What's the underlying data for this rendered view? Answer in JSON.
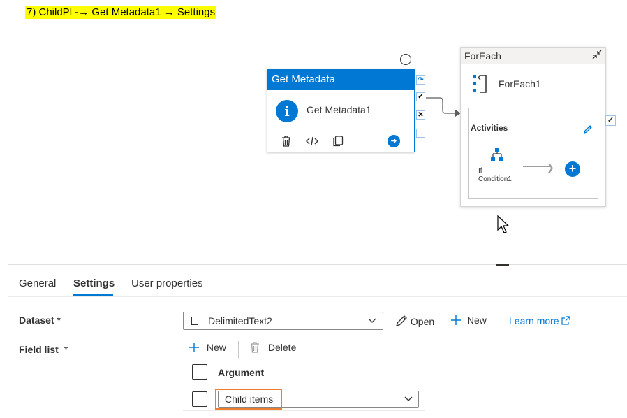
{
  "heading": "7)  ChildPl -→ Get Metadata1 → Settings",
  "canvas": {
    "get_metadata": {
      "type_label": "Get Metadata",
      "name": "Get Metadata1",
      "icons": [
        "info-icon",
        "delete-icon",
        "code-icon",
        "copy-icon",
        "go-arrow-icon"
      ],
      "side_icons": [
        "skip-icon",
        "success-check-icon",
        "failure-x-icon",
        "completion-arrow-icon"
      ]
    },
    "foreach": {
      "type_label": "ForEach",
      "name": "ForEach1",
      "activities_label": "Activities",
      "child_activity_line1": "If",
      "child_activity_line2": "Condition1"
    }
  },
  "panel": {
    "tabs": [
      {
        "label": "General",
        "active": false
      },
      {
        "label": "Settings",
        "active": true
      },
      {
        "label": "User properties",
        "active": false
      }
    ],
    "dataset": {
      "label": "Dataset",
      "required_mark": "*",
      "value": "DelimitedText2",
      "open_label": "Open",
      "new_label": "New",
      "learn_more_label": "Learn more"
    },
    "field_list": {
      "label": "Field list",
      "required_mark": "*",
      "new_label": "New",
      "delete_label": "Delete",
      "column_header": "Argument",
      "rows": [
        {
          "value": "Child items"
        }
      ]
    }
  },
  "colors": {
    "accent": "#0078d4",
    "highlight": "#ffff00",
    "annotation": "#ed7d31"
  }
}
